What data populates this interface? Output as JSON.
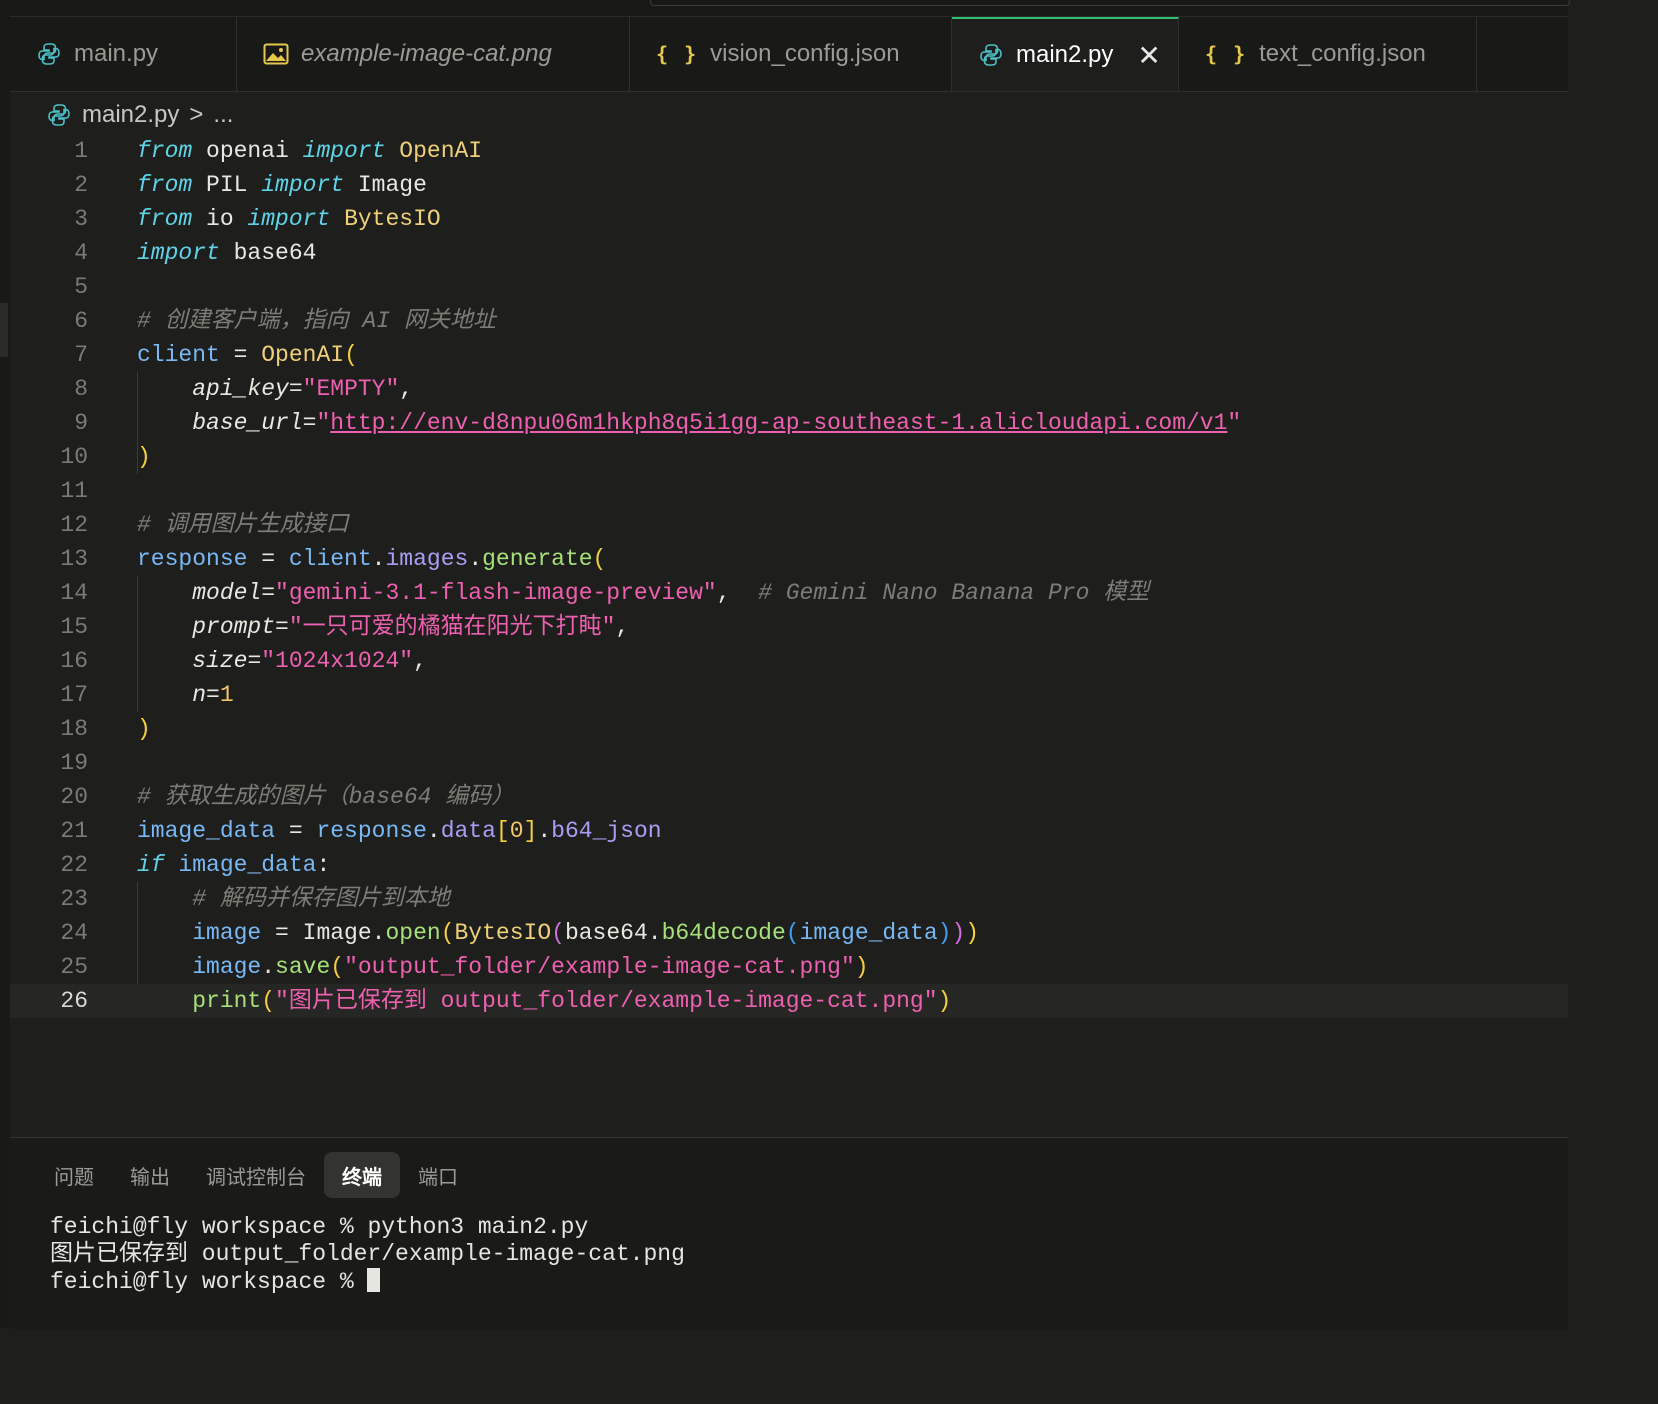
{
  "tabs": [
    {
      "label": "main.py",
      "icon": "python-icon",
      "italic": false
    },
    {
      "label": "example-image-cat.png",
      "icon": "image-icon",
      "italic": true
    },
    {
      "label": "vision_config.json",
      "icon": "json-braces-icon",
      "italic": false
    },
    {
      "label": "main2.py",
      "icon": "python-icon",
      "italic": false,
      "active": true,
      "close": "✕"
    },
    {
      "label": "text_config.json",
      "icon": "json-braces-icon",
      "italic": false
    }
  ],
  "json_icon_glyph": "{ }",
  "breadcrumb": {
    "file": "main2.py",
    "separator": ">",
    "rest": "..."
  },
  "code": {
    "line_numbers": [
      "1",
      "2",
      "3",
      "4",
      "5",
      "6",
      "7",
      "8",
      "9",
      "10",
      "11",
      "12",
      "13",
      "14",
      "15",
      "16",
      "17",
      "18",
      "19",
      "20",
      "21",
      "22",
      "23",
      "24",
      "25",
      "26"
    ],
    "current_line": "26",
    "lines": [
      [
        [
          "kw",
          "from"
        ],
        [
          "id",
          " openai "
        ],
        [
          "kw",
          "import"
        ],
        [
          "id",
          " "
        ],
        [
          "cls",
          "OpenAI"
        ]
      ],
      [
        [
          "kw",
          "from"
        ],
        [
          "id",
          " PIL "
        ],
        [
          "kw",
          "import"
        ],
        [
          "id",
          " Image"
        ]
      ],
      [
        [
          "kw",
          "from"
        ],
        [
          "id",
          " io "
        ],
        [
          "kw",
          "import"
        ],
        [
          "id",
          " "
        ],
        [
          "cls",
          "BytesIO"
        ]
      ],
      [
        [
          "kw",
          "import"
        ],
        [
          "id",
          " base64"
        ]
      ],
      [],
      [
        [
          "cmt",
          "# 创建客户端，指向 AI 网关地址"
        ]
      ],
      [
        [
          "var",
          "client"
        ],
        [
          "id",
          " = "
        ],
        [
          "cls",
          "OpenAI"
        ],
        [
          "p1",
          "("
        ]
      ],
      [
        [
          "id",
          "    "
        ],
        [
          "param",
          "api_key"
        ],
        [
          "id",
          "="
        ],
        [
          "str",
          "\"EMPTY\""
        ],
        [
          "id",
          ","
        ]
      ],
      [
        [
          "id",
          "    "
        ],
        [
          "param",
          "base_url"
        ],
        [
          "id",
          "="
        ],
        [
          "str",
          "\""
        ],
        [
          "str url",
          "http://env-d8npu06m1hkph8q5i1gg-ap-southeast-1.alicloudapi.com/v1"
        ],
        [
          "str",
          "\""
        ]
      ],
      [
        [
          "p1",
          ")"
        ]
      ],
      [],
      [
        [
          "cmt",
          "# 调用图片生成接口"
        ]
      ],
      [
        [
          "var",
          "response"
        ],
        [
          "id",
          " = "
        ],
        [
          "var",
          "client"
        ],
        [
          "id",
          "."
        ],
        [
          "prop",
          "images"
        ],
        [
          "id",
          "."
        ],
        [
          "fn",
          "generate"
        ],
        [
          "p1",
          "("
        ]
      ],
      [
        [
          "id",
          "    "
        ],
        [
          "param",
          "model"
        ],
        [
          "id",
          "="
        ],
        [
          "str",
          "\"gemini-3.1-flash-image-preview\""
        ],
        [
          "id",
          ",  "
        ],
        [
          "cmt",
          "# Gemini Nano Banana Pro 模型"
        ]
      ],
      [
        [
          "id",
          "    "
        ],
        [
          "param",
          "prompt"
        ],
        [
          "id",
          "="
        ],
        [
          "str",
          "\"一只可爱的橘猫在阳光下打盹\""
        ],
        [
          "id",
          ","
        ]
      ],
      [
        [
          "id",
          "    "
        ],
        [
          "param",
          "size"
        ],
        [
          "id",
          "="
        ],
        [
          "str",
          "\"1024x1024\""
        ],
        [
          "id",
          ","
        ]
      ],
      [
        [
          "id",
          "    "
        ],
        [
          "param",
          "n"
        ],
        [
          "id",
          "="
        ],
        [
          "num",
          "1"
        ]
      ],
      [
        [
          "p1",
          ")"
        ]
      ],
      [],
      [
        [
          "cmt",
          "# 获取生成的图片（base64 编码）"
        ]
      ],
      [
        [
          "var",
          "image_data"
        ],
        [
          "id",
          " = "
        ],
        [
          "var",
          "response"
        ],
        [
          "id",
          "."
        ],
        [
          "prop",
          "data"
        ],
        [
          "p1",
          "["
        ],
        [
          "num",
          "0"
        ],
        [
          "p1",
          "]"
        ],
        [
          "id",
          "."
        ],
        [
          "prop",
          "b64_json"
        ]
      ],
      [
        [
          "kw",
          "if"
        ],
        [
          "id",
          " "
        ],
        [
          "var",
          "image_data"
        ],
        [
          "id",
          ":"
        ]
      ],
      [
        [
          "id",
          "    "
        ],
        [
          "cmt",
          "# 解码并保存图片到本地"
        ]
      ],
      [
        [
          "id",
          "    "
        ],
        [
          "var",
          "image"
        ],
        [
          "id",
          " = Image."
        ],
        [
          "fn",
          "open"
        ],
        [
          "p1",
          "("
        ],
        [
          "cls",
          "BytesIO"
        ],
        [
          "p2",
          "("
        ],
        [
          "id",
          "base64."
        ],
        [
          "fn",
          "b64decode"
        ],
        [
          "p3",
          "("
        ],
        [
          "var",
          "image_data"
        ],
        [
          "p3",
          ")"
        ],
        [
          "p2",
          ")"
        ],
        [
          "p1",
          ")"
        ]
      ],
      [
        [
          "id",
          "    "
        ],
        [
          "var",
          "image"
        ],
        [
          "id",
          "."
        ],
        [
          "fn",
          "save"
        ],
        [
          "p1",
          "("
        ],
        [
          "str",
          "\"output_folder/example-image-cat.png\""
        ],
        [
          "p1",
          ")"
        ]
      ],
      [
        [
          "id",
          "    "
        ],
        [
          "fn",
          "print"
        ],
        [
          "p1",
          "("
        ],
        [
          "str",
          "\"图片已保存到 output_folder/example-image-cat.png\""
        ],
        [
          "p1",
          ")"
        ]
      ]
    ]
  },
  "panel": {
    "tabs": [
      "问题",
      "输出",
      "调试控制台",
      "终端",
      "端口"
    ],
    "active_tab": "终端",
    "terminal": [
      "feichi@fly workspace % python3 main2.py",
      "图片已保存到 output_folder/example-image-cat.png",
      "feichi@fly workspace % "
    ]
  },
  "colors": {
    "accent_active_tab": "#2fbf71",
    "editor_bg": "#1e1f1c",
    "keyword": "#5fd4e8",
    "string": "#ef5fb2",
    "class": "#f0cf7a"
  }
}
